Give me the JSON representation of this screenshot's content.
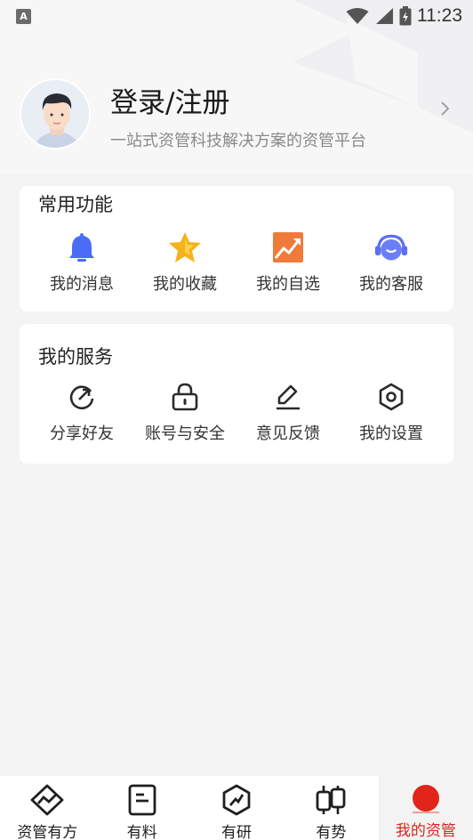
{
  "status_bar": {
    "app_badge": "A",
    "time": "11:23"
  },
  "profile": {
    "title": "登录/注册",
    "subtitle": "一站式资管科技解决方案的资管平台"
  },
  "common_functions": {
    "title": "常用功能",
    "items": [
      {
        "label": "我的消息",
        "icon": "bell-icon"
      },
      {
        "label": "我的收藏",
        "icon": "star-icon"
      },
      {
        "label": "我的自选",
        "icon": "trend-chart-icon"
      },
      {
        "label": "我的客服",
        "icon": "headset-icon"
      }
    ]
  },
  "my_services": {
    "title": "我的服务",
    "items": [
      {
        "label": "分享好友",
        "icon": "share-icon"
      },
      {
        "label": "账号与安全",
        "icon": "lock-icon"
      },
      {
        "label": "意见反馈",
        "icon": "edit-icon"
      },
      {
        "label": "我的设置",
        "icon": "settings-icon"
      }
    ]
  },
  "bottom_nav": {
    "items": [
      {
        "label": "资管有方",
        "icon": "diamond-chart-icon"
      },
      {
        "label": "有料",
        "icon": "document-icon"
      },
      {
        "label": "有研",
        "icon": "hexagon-trend-icon"
      },
      {
        "label": "有势",
        "icon": "candlestick-icon"
      },
      {
        "label": "我的资管",
        "icon": "profile-dot-icon"
      }
    ],
    "active_index": 4
  },
  "colors": {
    "accent": "#e1251b",
    "bell": "#4a6cf7",
    "star": "#f6b21a",
    "trend": "#f07a3a",
    "headset": "#5b6ff0"
  }
}
